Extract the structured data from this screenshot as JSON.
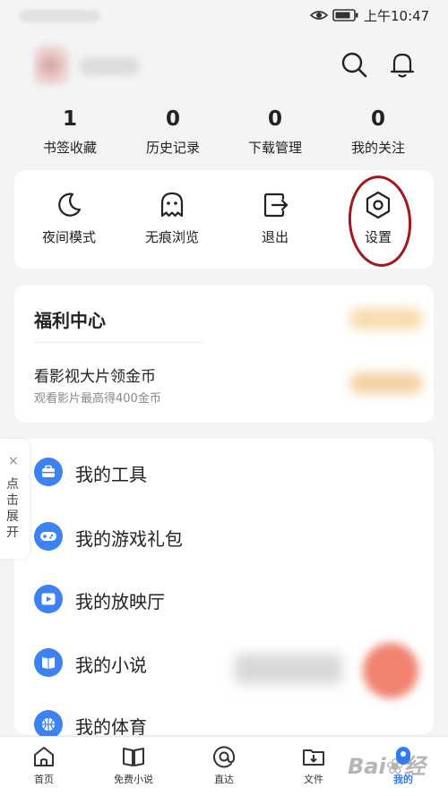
{
  "status_bar": {
    "time": "上午10:47"
  },
  "header": {
    "search_icon": "search-icon",
    "bell_icon": "bell-icon"
  },
  "stats": [
    {
      "value": "1",
      "label": "书签收藏"
    },
    {
      "value": "0",
      "label": "历史记录"
    },
    {
      "value": "0",
      "label": "下载管理"
    },
    {
      "value": "0",
      "label": "我的关注"
    }
  ],
  "quick_actions": [
    {
      "icon": "moon-icon",
      "label": "夜间模式"
    },
    {
      "icon": "ghost-icon",
      "label": "无痕浏览"
    },
    {
      "icon": "exit-icon",
      "label": "退出"
    },
    {
      "icon": "settings-hexagon-icon",
      "label": "设置"
    }
  ],
  "annotation": {
    "highlight_color": "#a3161c"
  },
  "welfare": {
    "title": "福利中心",
    "subtitle": "看影视大片领金币",
    "note": "观看影片最高得400金币"
  },
  "menu": [
    {
      "icon": "toolbox-icon",
      "label": "我的工具"
    },
    {
      "icon": "gamepad-icon",
      "label": "我的游戏礼包"
    },
    {
      "icon": "play-icon",
      "label": "我的放映厅"
    },
    {
      "icon": "book-icon",
      "label": "我的小说"
    },
    {
      "icon": "basketball-icon",
      "label": "我的体育"
    }
  ],
  "side_tab": {
    "close": "×",
    "label": "点击展开"
  },
  "bottom_nav": [
    {
      "icon": "home-icon",
      "label": "首页"
    },
    {
      "icon": "open-book-icon",
      "label": "免费小说"
    },
    {
      "icon": "at-icon",
      "label": "直达"
    },
    {
      "icon": "folder-download-icon",
      "label": "文件"
    },
    {
      "icon": "profile-icon",
      "label": "我的"
    }
  ],
  "accent_color": "#3d82f5",
  "watermark": "Bai❀经"
}
